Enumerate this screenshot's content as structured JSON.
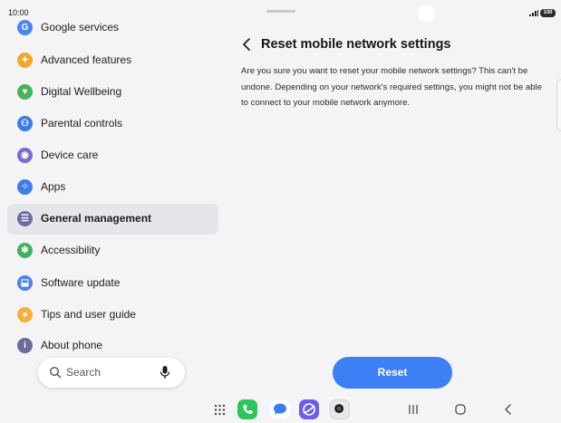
{
  "status_bar": {
    "time": "10:00",
    "battery": "100"
  },
  "sidebar": {
    "items": [
      {
        "label": "Google services",
        "color": "#4a86f0",
        "glyph": "G"
      },
      {
        "label": "Advanced features",
        "color": "#f0a92b",
        "glyph": "✦"
      },
      {
        "label": "Digital Wellbeing",
        "color": "#47b35b",
        "glyph": "♥"
      },
      {
        "label": "Parental controls",
        "color": "#3e79e8",
        "glyph": "⚇"
      },
      {
        "label": "Device care",
        "color": "#7b6ad0",
        "glyph": "◉"
      },
      {
        "label": "Apps",
        "color": "#3f7de9",
        "glyph": "⁘"
      },
      {
        "label": "General management",
        "color": "#6c6ea3",
        "glyph": "☰"
      },
      {
        "label": "Accessibility",
        "color": "#3fb35c",
        "glyph": "✱"
      },
      {
        "label": "Software update",
        "color": "#4f82e8",
        "glyph": "⬓"
      },
      {
        "label": "Tips and user guide",
        "color": "#f2b23a",
        "glyph": "●"
      },
      {
        "label": "About phone",
        "color": "#6d6a9e",
        "glyph": "i"
      }
    ],
    "active_index": 6
  },
  "search": {
    "placeholder": "Search"
  },
  "detail": {
    "title": "Reset mobile network settings",
    "description": "Are you sure you want to reset your mobile network settings? This can't be undone. Depending on your network's required settings, you might not be able to connect to your mobile network anymore.",
    "reset_label": "Reset",
    "accent": "#3d7ff5"
  },
  "dock": {
    "apps": [
      {
        "name": "phone-app-icon",
        "color": "#2ec45a"
      },
      {
        "name": "messages-app-icon",
        "color": "#ffffff"
      },
      {
        "name": "internet-app-icon",
        "color": "#6a5de8"
      },
      {
        "name": "camera-app-icon",
        "color": "#e8e8ea"
      }
    ]
  }
}
